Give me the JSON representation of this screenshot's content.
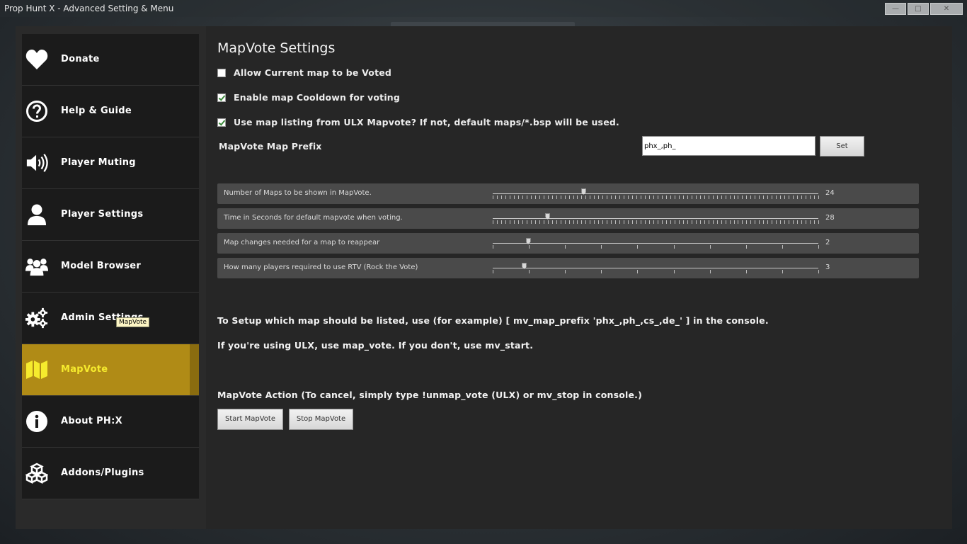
{
  "window": {
    "title": "Prop Hunt X - Advanced Setting & Menu",
    "minimize": "—",
    "maximize": "□",
    "close": "✕"
  },
  "sidebar": {
    "items": [
      {
        "label": "Donate",
        "icon": "heart-icon"
      },
      {
        "label": "Help & Guide",
        "icon": "question-circle-icon"
      },
      {
        "label": "Player Muting",
        "icon": "speaker-icon"
      },
      {
        "label": "Player Settings",
        "icon": "user-icon"
      },
      {
        "label": "Model Browser",
        "icon": "users-icon"
      },
      {
        "label": "Admin Settings",
        "icon": "gears-icon"
      },
      {
        "label": "MapVote",
        "icon": "map-icon",
        "active": true
      },
      {
        "label": "About PH:X",
        "icon": "info-circle-icon"
      },
      {
        "label": "Addons/Plugins",
        "icon": "cubes-icon"
      }
    ],
    "tooltip": "MapVote",
    "active_color": "#b08b16",
    "active_text_color": "#f6eb2d"
  },
  "main": {
    "title": "MapVote Settings",
    "checkboxes": [
      {
        "label": "Allow Current map to be Voted",
        "checked": false
      },
      {
        "label": "Enable map Cooldown for voting",
        "checked": true
      },
      {
        "label": "Use map listing from ULX Mapvote? If not, default maps/*.bsp will be used.",
        "checked": true
      }
    ],
    "prefix": {
      "label": "MapVote Map Prefix",
      "value": "phx_,ph_",
      "button": "Set"
    },
    "sliders": [
      {
        "label": "Number of Maps to be shown in MapVote.",
        "value": "24",
        "fraction": 0.279
      },
      {
        "label": "Time in Seconds for default mapvote when voting.",
        "value": "28",
        "fraction": 0.169
      },
      {
        "label": "Map changes needed for a map to reappear",
        "value": "2",
        "fraction": 0.109
      },
      {
        "label": "How many players required to use RTV (Rock the Vote)",
        "value": "3",
        "fraction": 0.097
      }
    ],
    "info_line1": "To Setup which map should be listed, use (for example) [ mv_map_prefix 'phx_,ph_,cs_,de_' ] in the console.",
    "info_line2": "If you're using ULX, use map_vote. If you don't, use mv_start.",
    "action_label": "MapVote Action (To cancel, simply type !unmap_vote (ULX) or mv_stop in console.)",
    "start_button": "Start MapVote",
    "stop_button": "Stop MapVote"
  }
}
